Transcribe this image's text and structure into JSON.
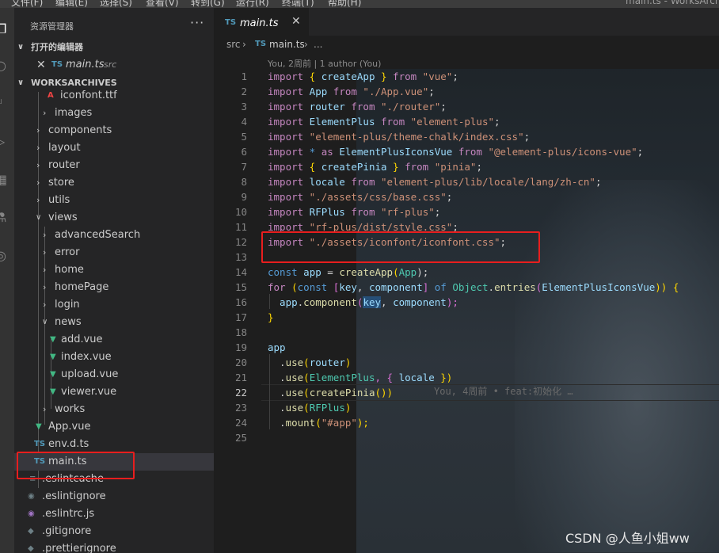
{
  "menubar": {
    "items": [
      "文件(F)",
      "编辑(E)",
      "选择(S)",
      "查看(V)",
      "转到(G)",
      "运行(R)",
      "终端(T)",
      "帮助(H)"
    ],
    "window_title": "main.ts - WorksArchives"
  },
  "explorer": {
    "title": "资源管理器",
    "more": "···",
    "open_editors_label": "打开的编辑器",
    "open_editor": {
      "icon": "TS",
      "name": "main.ts",
      "desc": "src"
    },
    "workspace_label": "WORKSARCHIVES",
    "tree": [
      {
        "name": "iconfont.ttf",
        "kind": "font"
      },
      {
        "name": "images",
        "kind": "folder"
      },
      {
        "name": "components",
        "kind": "folder"
      },
      {
        "name": "layout",
        "kind": "folder"
      },
      {
        "name": "router",
        "kind": "folder"
      },
      {
        "name": "store",
        "kind": "folder"
      },
      {
        "name": "utils",
        "kind": "folder"
      },
      {
        "name": "views",
        "kind": "folder-open"
      },
      {
        "name": "advancedSearch",
        "kind": "folder"
      },
      {
        "name": "error",
        "kind": "folder"
      },
      {
        "name": "home",
        "kind": "folder"
      },
      {
        "name": "homePage",
        "kind": "folder"
      },
      {
        "name": "login",
        "kind": "folder"
      },
      {
        "name": "news",
        "kind": "folder-open"
      },
      {
        "name": "add.vue",
        "kind": "vue"
      },
      {
        "name": "index.vue",
        "kind": "vue"
      },
      {
        "name": "upload.vue",
        "kind": "vue"
      },
      {
        "name": "viewer.vue",
        "kind": "vue"
      },
      {
        "name": "works",
        "kind": "folder"
      },
      {
        "name": "App.vue",
        "kind": "vue"
      },
      {
        "name": "env.d.ts",
        "kind": "ts"
      },
      {
        "name": "main.ts",
        "kind": "ts"
      },
      {
        "name": ".eslintcache",
        "kind": "file"
      },
      {
        "name": ".eslintignore",
        "kind": "cfg"
      },
      {
        "name": ".eslintrc.js",
        "kind": "js"
      },
      {
        "name": ".gitignore",
        "kind": "cfg"
      },
      {
        "name": ".prettierignore",
        "kind": "cfg"
      }
    ]
  },
  "tab": {
    "icon": "TS",
    "name": "main.ts",
    "close": "✕"
  },
  "breadcrumb": {
    "folder": "src",
    "sep": "›",
    "icon": "TS",
    "file": "main.ts",
    "tail": "..."
  },
  "blame_header": "You, 2周前 | 1 author (You)",
  "inline_blame": "You, 4周前 • feat:初始化 …",
  "line_numbers": [
    "1",
    "2",
    "3",
    "4",
    "5",
    "6",
    "7",
    "8",
    "9",
    "10",
    "11",
    "12",
    "13",
    "14",
    "15",
    "16",
    "17",
    "18",
    "19",
    "20",
    "21",
    "22",
    "23",
    "24",
    "25"
  ],
  "code": {
    "l1": {
      "a": "import",
      "b": " { ",
      "c": "createApp",
      "d": " } ",
      "e": "from",
      "f": " \"vue\"",
      "g": ";"
    },
    "l2": {
      "a": "import",
      "b": " App ",
      "c": "from",
      "d": " \"./App.vue\"",
      "e": ";"
    },
    "l3": {
      "a": "import",
      "b": " router ",
      "c": "from",
      "d": " \"./router\"",
      "e": ";"
    },
    "l4": {
      "a": "import",
      "b": " ElementPlus ",
      "c": "from",
      "d": " \"element-plus\"",
      "e": ";"
    },
    "l5": {
      "a": "import",
      "b": " \"element-plus/theme-chalk/index.css\"",
      "c": ";"
    },
    "l6": {
      "a": "import",
      "b": " * ",
      "c": "as",
      "d": " ElementPlusIconsVue ",
      "e": "from",
      "f": " \"@element-plus/icons-vue\"",
      "g": ";"
    },
    "l7": {
      "a": "import",
      "b": " { ",
      "c": "createPinia",
      "d": " } ",
      "e": "from",
      "f": " \"pinia\"",
      "g": ";"
    },
    "l8": {
      "a": "import",
      "b": " locale ",
      "c": "from",
      "d": " \"element-plus/lib/locale/lang/zh-cn\"",
      "e": ";"
    },
    "l9": {
      "a": "import",
      "b": " \"./assets/css/base.css\"",
      "c": ";"
    },
    "l10": {
      "a": "import",
      "b": " RFPlus ",
      "c": "from",
      "d": " \"rf-plus\"",
      "e": ";"
    },
    "l11": {
      "a": "import",
      "b": " \"rf-plus/dist/style.css\"",
      "c": ";"
    },
    "l12": {
      "a": "import",
      "b": " \"./assets/iconfont/iconfont.css\"",
      "c": ";"
    },
    "l14": {
      "a": "const",
      "b": " app ",
      "c": "= ",
      "d": "createApp",
      "e": "(",
      "f": "App",
      "g": ");"
    },
    "l15": {
      "a": "for",
      "b": " (",
      "c": "const",
      "d": " [",
      "e": "key",
      "f": ", ",
      "g": "component",
      "h": "] ",
      "i": "of",
      "j": " Object",
      "k": ".",
      "l": "entries",
      "m": "(",
      "n": "ElementPlusIconsVue",
      "o": ")) {"
    },
    "l16": {
      "a": "  app",
      "b": ".",
      "c": "component",
      "d": "(",
      "e": "key",
      "f": ", ",
      "g": "component",
      "h": ");"
    },
    "l17": {
      "a": "}"
    },
    "l19": {
      "a": "app"
    },
    "l20": {
      "a": "  .",
      "b": "use",
      "c": "(",
      "d": "router",
      "e": ")"
    },
    "l21": {
      "a": "  .",
      "b": "use",
      "c": "(",
      "d": "ElementPlus",
      "e": ", { ",
      "f": "locale",
      "g": " })"
    },
    "l22": {
      "a": "  .",
      "b": "use",
      "c": "(",
      "d": "createPinia",
      "e": "())"
    },
    "l23": {
      "a": "  .",
      "b": "use",
      "c": "(",
      "d": "RFPlus",
      "e": ")"
    },
    "l24": {
      "a": "  .",
      "b": "mount",
      "c": "(",
      "d": "\"#app\"",
      "e": ");"
    }
  },
  "watermark": "CSDN @人鱼小姐ww",
  "colors": {
    "highlight_box": "#e81e1e",
    "keyword": "#c586c0",
    "string": "#ce9178",
    "variable": "#9cdcfe",
    "class": "#4ec9b0",
    "function": "#dcdcaa"
  }
}
